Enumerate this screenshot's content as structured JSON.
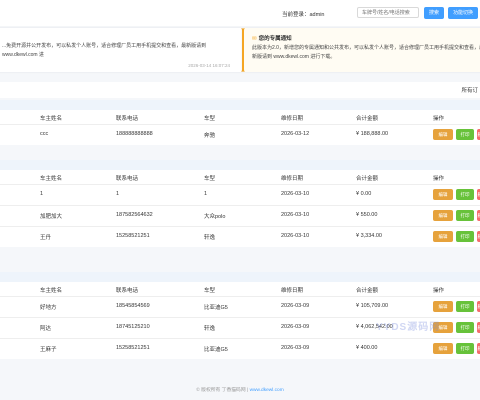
{
  "topbar": {
    "user_text": "当前登录：admin",
    "search_placeholder": "车牌号/姓名/电话搜索",
    "search_button": "搜索",
    "extra_button": "功能切换"
  },
  "notices": {
    "left": {
      "text": "...免费开源并公开发布，可以私发个人账号，适合修理厂员工用手机提交和查看，最新版请到 www.dkewl.com 进",
      "time": "2026-03-14 16:07:24"
    },
    "right": {
      "title": "您的专属通知",
      "text": "此版本为2.0，新增您的专属通知和公共发布，可以私发个人账号，适合修理厂员工用手机提交和查看，最新版请到 www.dkewl.com 进行下载。"
    }
  },
  "filter": {
    "all_label": "所有订"
  },
  "table_headers": {
    "name": "车主姓名",
    "phone": "联系电话",
    "model": "车型",
    "date": "维修日期",
    "total": "合计金额",
    "actions": "操作"
  },
  "actions": {
    "edit": "编辑",
    "print": "打印",
    "del": "删除"
  },
  "groups": [
    {
      "rows": [
        {
          "name": "ccc",
          "phone": "188888888888",
          "model": "奔驰",
          "date": "2026-03-12",
          "total": "¥ 188,888.00"
        }
      ]
    },
    {
      "rows": [
        {
          "name": "1",
          "phone": "1",
          "model": "1",
          "date": "2026-03-10",
          "total": "¥ 0.00"
        },
        {
          "name": "加肥加大",
          "phone": "187582564632",
          "model": "大众polo",
          "date": "2026-03-10",
          "total": "¥ 550.00"
        },
        {
          "name": "王丹",
          "phone": "15258521251",
          "model": "轩逸",
          "date": "2026-03-10",
          "total": "¥ 3,334.00"
        }
      ]
    },
    {
      "rows": [
        {
          "name": "好地方",
          "phone": "18545854569",
          "model": "比亚迪G5",
          "date": "2026-03-09",
          "total": "¥ 105,709.00"
        },
        {
          "name": "阿达",
          "phone": "18745125210",
          "model": "轩逸",
          "date": "2026-03-09",
          "total": "¥ 4,062,542.00"
        },
        {
          "name": "王麻子",
          "phone": "15258521251",
          "model": "比亚迪G5",
          "date": "2026-03-09",
          "total": "¥ 400.00"
        }
      ]
    }
  ],
  "footer": {
    "text": "© 版权所有 丁香猫码网 | ",
    "link": "www.dkewl.com"
  },
  "watermark": "YYDS源码网"
}
